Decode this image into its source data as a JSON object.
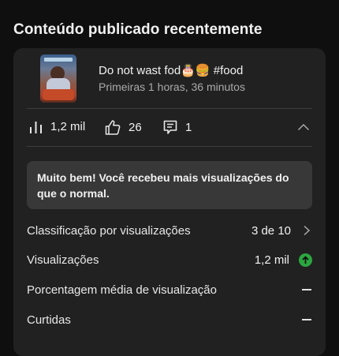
{
  "section": {
    "title": "Conteúdo publicado recentemente"
  },
  "video": {
    "title": "Do not wast fod🎂🍔 #food",
    "subtitle": "Primeiras 1 horas, 36 minutos"
  },
  "stats": {
    "views": "1,2 mil",
    "likes": "26",
    "comments": "1"
  },
  "banner": {
    "message": "Muito bem! Você recebeu mais visualizações do que o normal."
  },
  "metrics": [
    {
      "label": "Classificação por visualizações",
      "value": "3 de 10"
    },
    {
      "label": "Visualizações",
      "value": "1,2 mil"
    },
    {
      "label": "Porcentagem média de visualização",
      "value": ""
    },
    {
      "label": "Curtidas",
      "value": ""
    }
  ],
  "colors": {
    "background": "#0f0f0f",
    "card": "#212121",
    "banner": "#383838",
    "trend_up": "#2ba640"
  }
}
